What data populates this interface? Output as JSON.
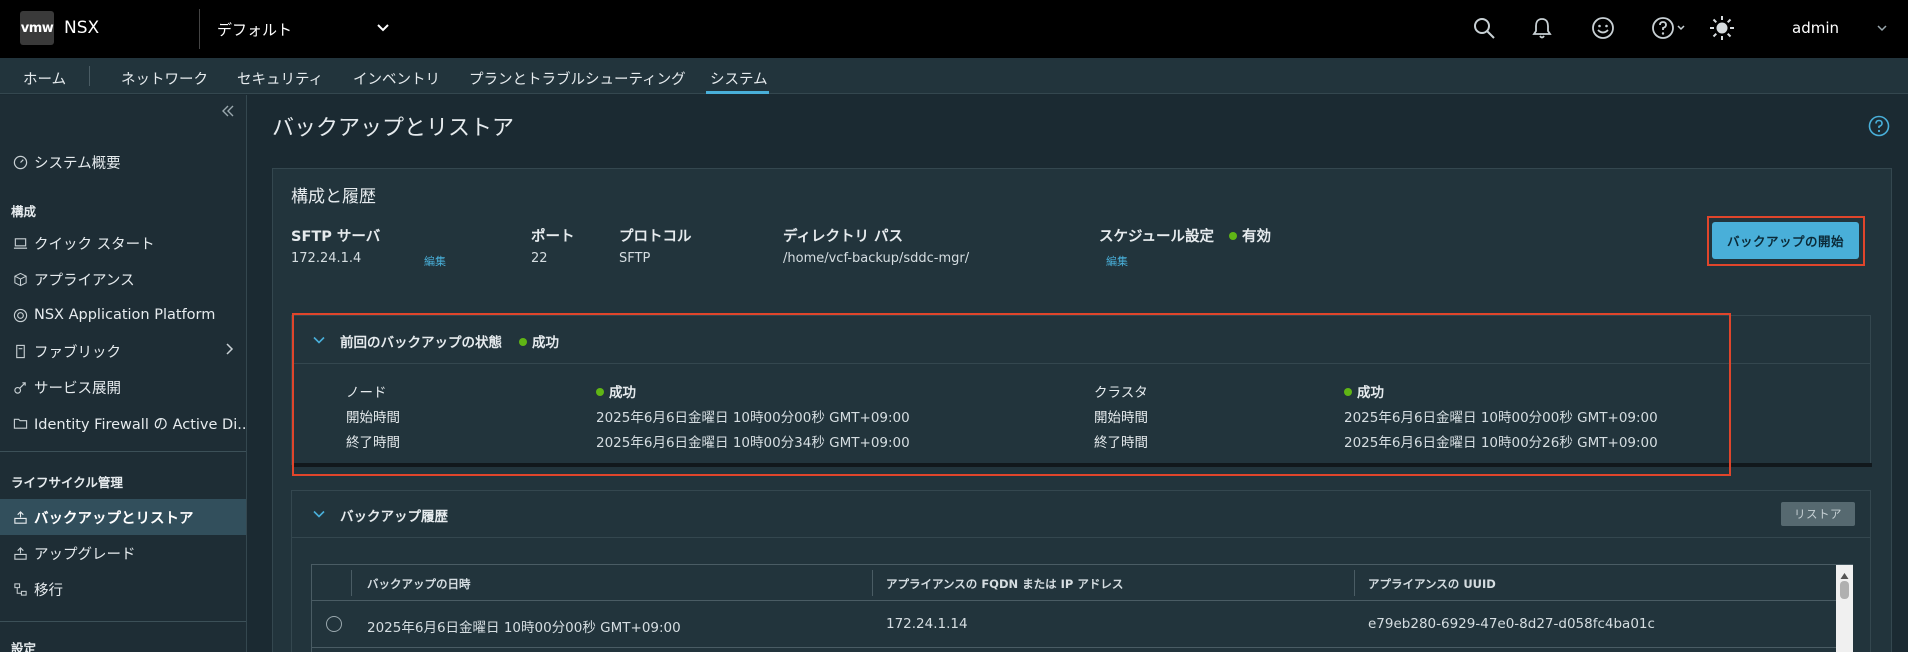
{
  "header": {
    "logo_text": "vmw",
    "app_name": "NSX",
    "tenant": "デフォルト",
    "user": "admin"
  },
  "nav": {
    "tabs": [
      {
        "label": "ホーム"
      },
      {
        "label": "ネットワーク"
      },
      {
        "label": "セキュリティ"
      },
      {
        "label": "インベントリ"
      },
      {
        "label": "プランとトラブルシューティング"
      },
      {
        "label": "システム"
      }
    ],
    "active_tab": "システム"
  },
  "sidebar": {
    "items": [
      {
        "label": "システム概要",
        "icon": "gauge-icon"
      },
      {
        "label": "クイック スタート",
        "icon": "laptop-icon"
      },
      {
        "label": "アプライアンス",
        "icon": "box-icon"
      },
      {
        "label": "NSX Application Platform",
        "icon": "circle-target-icon"
      },
      {
        "label": "ファブリック",
        "icon": "server-icon"
      },
      {
        "label": "サービス展開",
        "icon": "deploy-icon"
      },
      {
        "label": "Identity Firewall の Active Di...",
        "icon": "folder-icon"
      },
      {
        "label": "バックアップとリストア",
        "icon": "backup-icon"
      },
      {
        "label": "アップグレード",
        "icon": "upgrade-icon"
      },
      {
        "label": "移行",
        "icon": "migrate-icon"
      }
    ],
    "sections": {
      "config": "構成",
      "lifecycle": "ライフサイクル管理",
      "settings": "設定"
    }
  },
  "page": {
    "title": "バックアップとリストア"
  },
  "config_card": {
    "title": "構成と履歴",
    "sftp_label": "SFTP サーバ",
    "sftp_value": "172.24.1.4",
    "edit_label": "編集",
    "port_label": "ポート",
    "port_value": "22",
    "protocol_label": "プロトコル",
    "protocol_value": "SFTP",
    "dir_label": "ディレクトリ パス",
    "dir_value": "/home/vcf-backup/sddc-mgr/",
    "schedule_label": "スケジュール設定",
    "schedule_status": "有効",
    "start_button": "バックアップの開始"
  },
  "last_backup": {
    "title": "前回のバックアップの状態",
    "status": "成功",
    "node_label": "ノード",
    "node_status": "成功",
    "node_start_label": "開始時間",
    "node_start": "2025年6月6日金曜日 10時00分00秒 GMT+09:00",
    "node_end_label": "終了時間",
    "node_end": "2025年6月6日金曜日 10時00分34秒 GMT+09:00",
    "cluster_label": "クラスタ",
    "cluster_status": "成功",
    "cluster_start_label": "開始時間",
    "cluster_start": "2025年6月6日金曜日 10時00分00秒 GMT+09:00",
    "cluster_end_label": "終了時間",
    "cluster_end": "2025年6月6日金曜日 10時00分26秒 GMT+09:00"
  },
  "history": {
    "title": "バックアップ履歴",
    "restore_button": "リストア",
    "columns": [
      "バックアップの日時",
      "アプライアンスの FQDN または IP アドレス",
      "アプライアンスの UUID"
    ],
    "rows": [
      [
        "2025年6月6日金曜日 10時00分00秒 GMT+09:00",
        "172.24.1.14",
        "e79eb280-6929-47e0-8d27-d058fc4ba01c"
      ]
    ]
  },
  "colors": {
    "accent": "#49afd9",
    "success": "#60b515",
    "highlight": "#e0452b"
  }
}
